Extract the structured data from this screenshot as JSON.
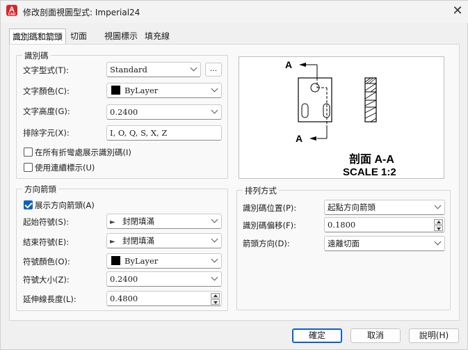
{
  "window": {
    "title": "修改剖面視圖型式: Imperial24",
    "close_glyph": "✕",
    "app_icon_letter": "A",
    "app_icon_sub": "CAD"
  },
  "tabs": [
    {
      "label": "識別碼和箭頭",
      "active": true
    },
    {
      "label": "切面",
      "active": false
    },
    {
      "label": "視圖標示",
      "active": false
    },
    {
      "label": "填充線",
      "active": false
    }
  ],
  "identifier": {
    "group_title": "識別碼",
    "text_style": {
      "label": "文字型式(T):",
      "value": "Standard",
      "browse_label": "..."
    },
    "text_color": {
      "label": "文字顏色(C):",
      "value": "ByLayer",
      "swatch": "#000000"
    },
    "text_height": {
      "label": "文字高度(G):",
      "value": "0.2400"
    },
    "exclude_chars": {
      "label": "排除字元(X):",
      "value": "I, O, Q, S, X, Z"
    },
    "show_at_bends": {
      "label": "在所有折彎處展示識別碼(I)",
      "checked": false
    },
    "continuous_labels": {
      "label": "使用連續標示(U)",
      "checked": false
    }
  },
  "arrows": {
    "group_title": "方向箭頭",
    "show_arrows": {
      "label": "展示方向箭頭(A)",
      "checked": true
    },
    "start_symbol": {
      "label": "起始符號(S):",
      "value": "封閉填滿",
      "icon": "arrow-right-icon"
    },
    "end_symbol": {
      "label": "結束符號(E):",
      "value": "封閉填滿",
      "icon": "arrow-right-icon"
    },
    "symbol_color": {
      "label": "符號顏色(O):",
      "value": "ByLayer",
      "swatch": "#000000"
    },
    "symbol_size": {
      "label": "符號大小(Z):",
      "value": "0.2400"
    },
    "extension_length": {
      "label": "延伸線長度(L):",
      "value": "0.4800"
    }
  },
  "layout": {
    "group_title": "排列方式",
    "identifier_position": {
      "label": "識別碼位置(P):",
      "value": "起點方向箭頭"
    },
    "identifier_offset": {
      "label": "識別碼偏移(F):",
      "value": "0.1800"
    },
    "arrow_direction": {
      "label": "箭頭方向(D):",
      "value": "遠離切面"
    }
  },
  "preview": {
    "label_top": "A",
    "label_bottom": "A",
    "section_title": "剖面 A-A",
    "scale_text": "SCALE 1:2"
  },
  "buttons": {
    "ok": "確定",
    "cancel": "取消",
    "help": "說明(H)"
  }
}
